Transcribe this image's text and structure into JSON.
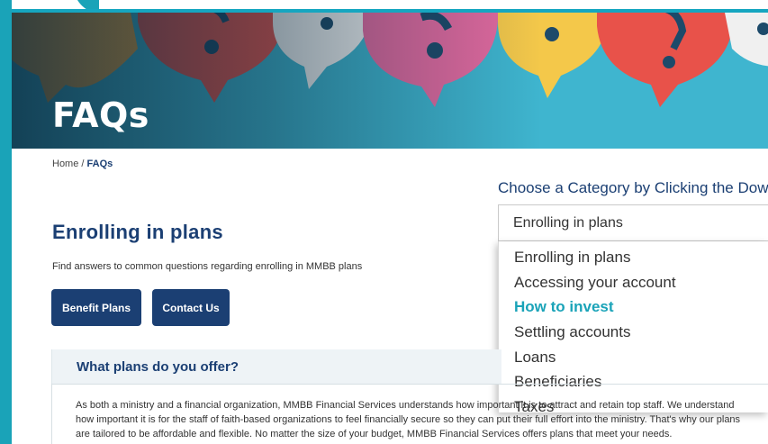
{
  "hero": {
    "title": "FAQs"
  },
  "breadcrumb": {
    "home": "Home",
    "separator": " / ",
    "current": "FAQs"
  },
  "category": {
    "prompt": "Choose a Category by Clicking the Down",
    "selected": "Enrolling in plans",
    "options": [
      "Enrolling in plans",
      "Accessing your account",
      "How to invest",
      "Settling accounts",
      "Loans",
      "Beneficiaries",
      "Taxes"
    ],
    "active_option": "How to invest"
  },
  "section": {
    "title": "Enrolling in plans",
    "subtitle": "Find answers to common questions regarding enrolling in MMBB plans"
  },
  "buttons": {
    "benefit_plans": "Benefit Plans",
    "contact_us": "Contact Us"
  },
  "faq": {
    "question": "What plans do you offer?",
    "answer": "As both a ministry and a financial organization, MMBB Financial Services understands how important it is to attract and retain top staff. We understand how important it is for the staff of faith-based organizations to feel financially secure so they can put their full effort into the ministry. That's why our plans are tailored to be affordable and flexible. No matter the size of your budget, MMBB Financial Services offers plans that meet your needs."
  },
  "colors": {
    "navy": "#1b3f73",
    "teal": "#1aa3b8",
    "hero_bg": "#3fb5cf"
  }
}
